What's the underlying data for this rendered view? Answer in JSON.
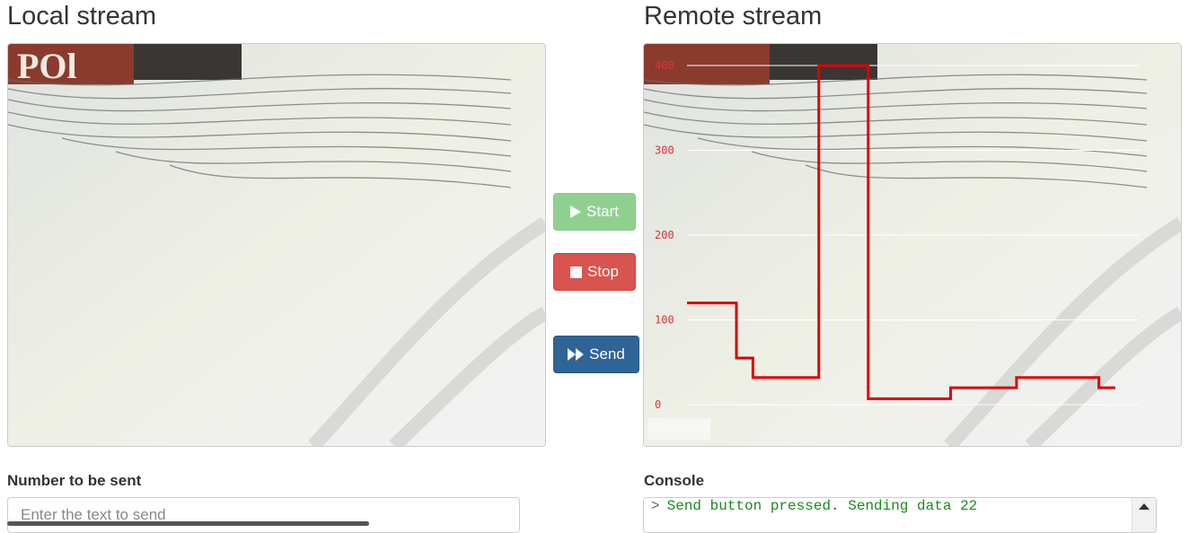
{
  "local": {
    "title": "Local stream"
  },
  "remote": {
    "title": "Remote stream",
    "y_ticks": [
      "400",
      "300",
      "200",
      "100",
      "0"
    ]
  },
  "buttons": {
    "start": "Start",
    "stop": "Stop",
    "send": "Send"
  },
  "number_field": {
    "label": "Number to be sent",
    "placeholder": "Enter the text to send"
  },
  "console": {
    "label": "Console",
    "prompt": ">",
    "lines": [
      "Send button pressed. Sending data 22"
    ]
  },
  "colors": {
    "start": "#8fd08f",
    "stop": "#d9534f",
    "send": "#2e6496",
    "plot_line": "#e00000",
    "console_text": "#1a8a1a"
  },
  "chart_data": {
    "type": "line",
    "ylim": [
      0,
      400
    ],
    "grid": true,
    "series": [
      {
        "values": [
          120,
          120,
          120,
          55,
          32,
          32,
          32,
          32,
          400,
          400,
          400,
          7,
          7,
          7,
          7,
          7,
          20,
          20,
          20,
          20,
          32,
          32,
          32,
          32,
          32,
          20,
          20
        ]
      }
    ]
  }
}
